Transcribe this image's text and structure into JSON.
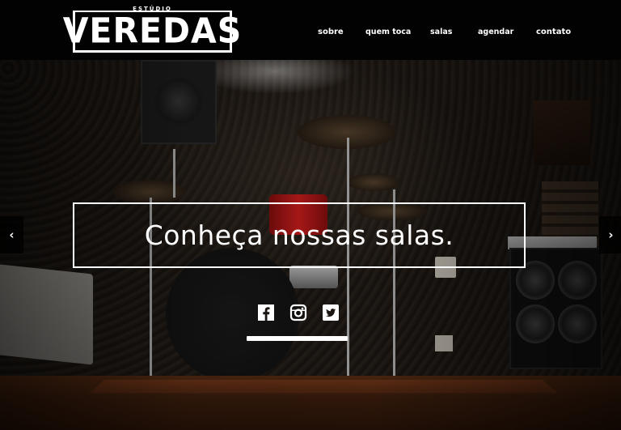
{
  "brand": {
    "small": "ESTÚDIO",
    "word": "VEREDAS"
  },
  "nav": {
    "items": [
      {
        "label": "sobre"
      },
      {
        "label": "quem toca"
      },
      {
        "label": "salas"
      },
      {
        "label": "agendar"
      },
      {
        "label": "contato"
      }
    ]
  },
  "hero": {
    "caption": "Conheça nossas salas.",
    "prev_icon": "chevron-left-icon",
    "next_icon": "chevron-right-icon",
    "prev_glyph": "‹",
    "next_glyph": "›"
  },
  "social": {
    "icons": [
      "facebook-icon",
      "instagram-icon",
      "twitter-icon"
    ]
  },
  "colors": {
    "header_bg": "#020202",
    "text": "#ffffff",
    "drum_red": "#c01818"
  }
}
